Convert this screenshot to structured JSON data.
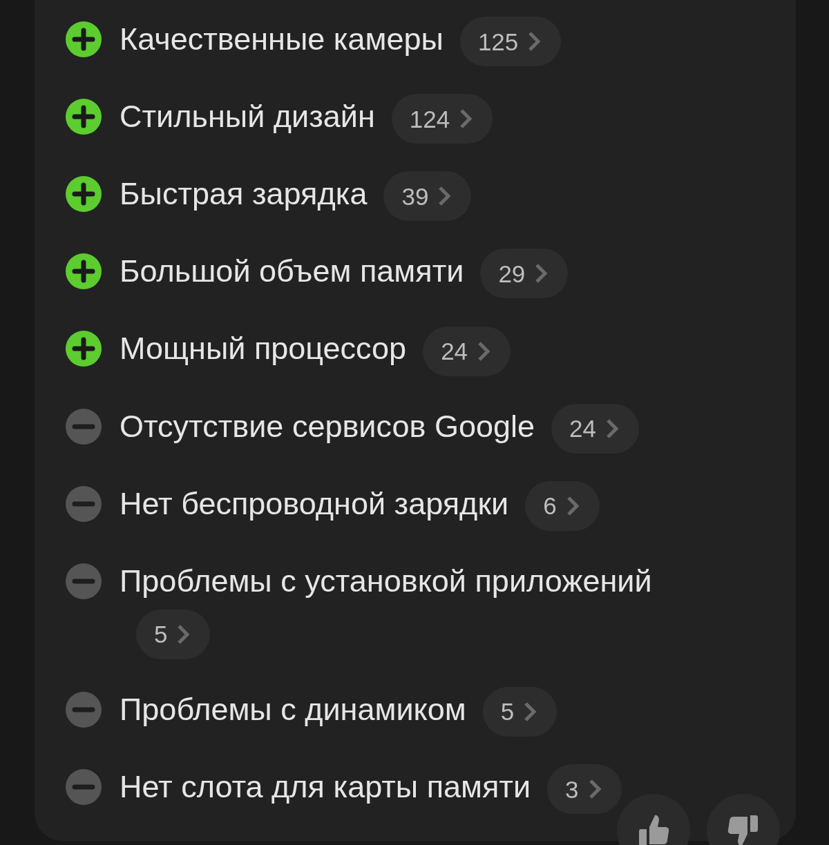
{
  "aspects": [
    {
      "kind": "pro",
      "label": "Качественные камеры",
      "count": "125"
    },
    {
      "kind": "pro",
      "label": "Стильный дизайн",
      "count": "124"
    },
    {
      "kind": "pro",
      "label": "Быстрая зарядка",
      "count": "39"
    },
    {
      "kind": "pro",
      "label": "Большой объем памяти",
      "count": "29"
    },
    {
      "kind": "pro",
      "label": "Мощный процессор",
      "count": "24"
    },
    {
      "kind": "con",
      "label": "Отсутствие сервисов Google",
      "count": "24"
    },
    {
      "kind": "con",
      "label": "Нет беспроводной зарядки",
      "count": "6"
    },
    {
      "kind": "con",
      "label": "Проблемы с установкой приложений",
      "count": "5"
    },
    {
      "kind": "con",
      "label": "Проблемы с динамиком",
      "count": "5"
    },
    {
      "kind": "con",
      "label": "Нет слота для карты памяти",
      "count": "3"
    }
  ],
  "feedback": [
    {
      "kind": "like"
    },
    {
      "kind": "dislike"
    }
  ]
}
